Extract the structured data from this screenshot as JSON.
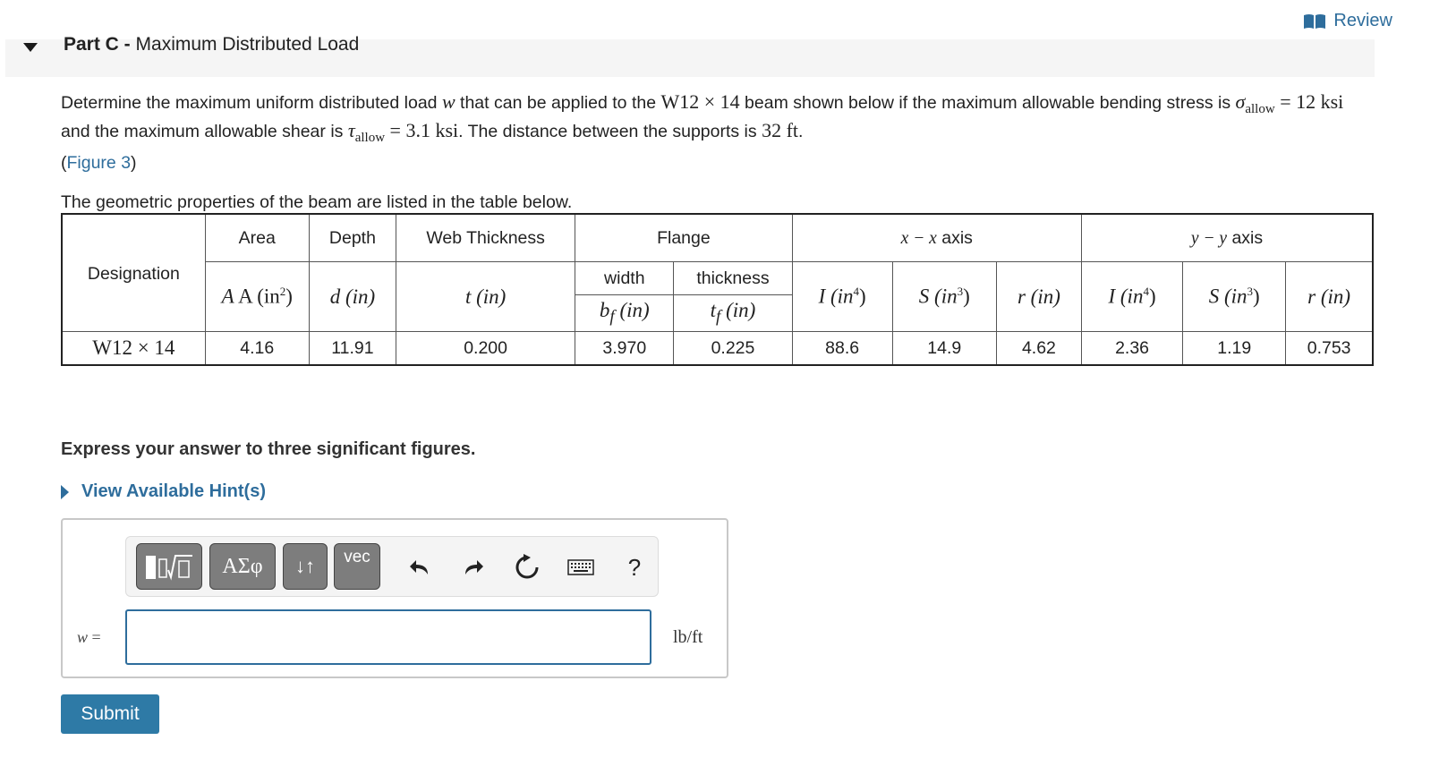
{
  "review": {
    "label": "Review",
    "icon": "book-icon"
  },
  "part": {
    "prefix": "Part C - ",
    "title": "Maximum Distributed Load"
  },
  "problem": {
    "t1": "Determine the maximum uniform distributed load ",
    "w": "w",
    "t2": " that can be applied to the ",
    "beam": "W12 × 14",
    "t3": " beam shown below if the maximum allowable bending stress is ",
    "sigma": "σ",
    "sub_allow": "allow",
    "eq_sigma": " = 12 ksi",
    "t4": " and the maximum allowable shear is ",
    "tau": "τ",
    "eq_tau": " = 3.1 ksi",
    "t5": ". The distance between the supports is ",
    "dist": "32 ft",
    "t6": "."
  },
  "figure_link": {
    "open": "(",
    "label": "Figure 3",
    "close": ")"
  },
  "table_caption": "The geometric properties of the beam are listed in the table below.",
  "table": {
    "h_designation": "Designation",
    "h_area": "Area",
    "h_depth": "Depth",
    "h_web": "Web Thickness",
    "h_flange": "Flange",
    "h_xaxis_var": "x − x",
    "h_xaxis_word": " axis",
    "h_yaxis_var": "y − y",
    "h_yaxis_word": " axis",
    "h_width": "width",
    "h_thickness": "thickness",
    "u_area": "A (in",
    "u_depth": "d (in)",
    "u_web": "t (in)",
    "u_bf": "b",
    "u_bf_sub": "f",
    "u_bf_rest": " (in)",
    "u_tf": "t",
    "u_tf_sub": "f",
    "u_tf_rest": " (in)",
    "u_I": "I (in",
    "u_S": "S (in",
    "u_r": "r (in)",
    "exp2": "2",
    "exp3": "3",
    "exp4": "4",
    "close_paren": ")",
    "row": {
      "designation": "W12 × 14",
      "area": "4.16",
      "depth": "11.91",
      "web": "0.200",
      "bf": "3.970",
      "tf": "0.225",
      "Ix": "88.6",
      "Sx": "14.9",
      "rx": "4.62",
      "Iy": "2.36",
      "Sy": "1.19",
      "ry": "0.753"
    }
  },
  "instruction": "Express your answer to three significant figures.",
  "hints": {
    "label": "View Available Hint(s)"
  },
  "toolbar": {
    "greek": "ΑΣφ",
    "arrows": "↓↑",
    "vec": "vec",
    "help": "?"
  },
  "answer": {
    "var": "w",
    "eq": " =",
    "value": "",
    "unit": "lb/ft"
  },
  "submit": {
    "label": "Submit"
  }
}
